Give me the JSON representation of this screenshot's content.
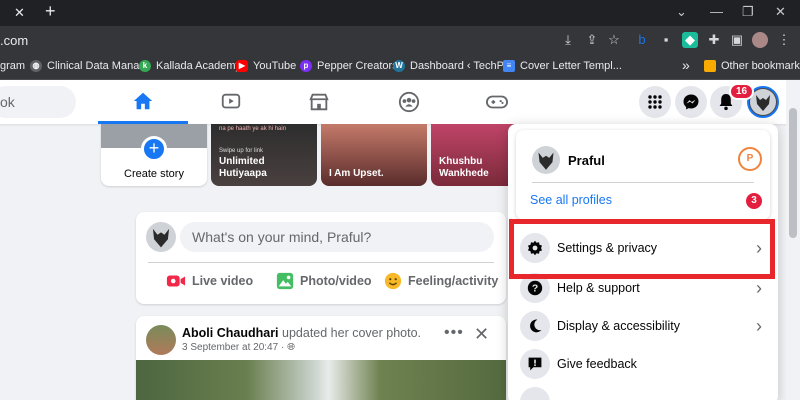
{
  "browser": {
    "url": ".com",
    "bookmarks": [
      {
        "label": "gram",
        "color": "#e1306c"
      },
      {
        "label": "Clinical Data Mana...",
        "color": "#5f6368"
      },
      {
        "label": "Kallada Academy",
        "color": "#34a853"
      },
      {
        "label": "YouTube",
        "color": "#ff0000"
      },
      {
        "label": "Pepper Creators",
        "color": "#7b2ff7"
      },
      {
        "label": "Dashboard ‹ TechP...",
        "color": "#21759b"
      },
      {
        "label": "Cover Letter Templ...",
        "color": "#4285f4"
      }
    ],
    "more_bookmarks": "»",
    "other_bookmarks": "Other bookmarks"
  },
  "fb": {
    "search_placeholder": "ok",
    "nav_icons": [
      "home-icon",
      "watch-icon",
      "marketplace-icon",
      "groups-icon",
      "gaming-icon"
    ],
    "notif_count": "16",
    "brand_color": "#1877f2"
  },
  "stories": {
    "create_label": "Create story",
    "items": [
      {
        "text": "Unlimited\nHutiyaapa",
        "small": "Swipe up for link",
        "top": "na pe haath ye ak hi hain",
        "bg": "#3a3a3a"
      },
      {
        "text": "I Am Upset.",
        "small": "",
        "top": "",
        "bg": "#7a3e3e"
      },
      {
        "text": "Khushbu\nWankhede",
        "small": "",
        "top": "",
        "bg": "#a0405a"
      }
    ]
  },
  "composer": {
    "placeholder": "What's on your mind, Praful?",
    "live": "Live video",
    "photo": "Photo/video",
    "feeling": "Feeling/activity"
  },
  "post": {
    "author": "Aboli Chaudhari",
    "action": "updated her cover photo.",
    "date": "3 September at 20:47 ·"
  },
  "menu": {
    "profile_name": "Praful",
    "see_all": "See all profiles",
    "see_all_count": "3",
    "items": [
      {
        "label": "Settings & privacy"
      },
      {
        "label": "Help & support"
      },
      {
        "label": "Display & accessibility"
      },
      {
        "label": "Give feedback"
      }
    ]
  }
}
